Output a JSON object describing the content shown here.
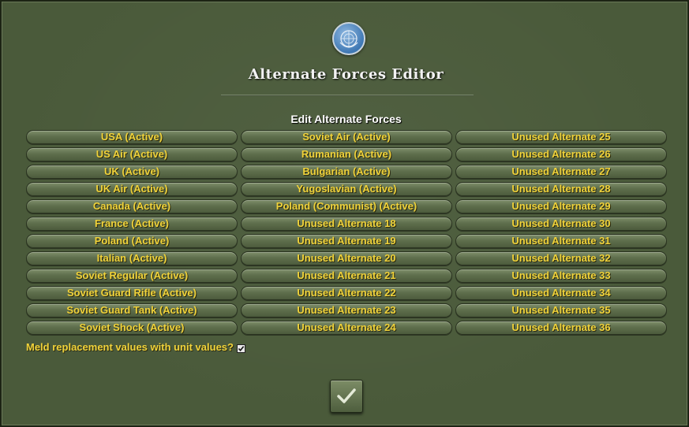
{
  "dialog": {
    "title": "Alternate Forces Editor",
    "subtitle": "Edit Alternate Forces"
  },
  "forces": {
    "column1": [
      "USA (Active)",
      "US Air (Active)",
      "UK (Active)",
      "UK Air (Active)",
      "Canada (Active)",
      "France (Active)",
      "Poland (Active)",
      "Italian (Active)",
      "Soviet Regular (Active)",
      "Soviet Guard Rifle (Active)",
      "Soviet Guard Tank (Active)",
      "Soviet Shock (Active)"
    ],
    "column2": [
      "Soviet Air (Active)",
      "Rumanian (Active)",
      "Bulgarian (Active)",
      "Yugoslavian (Active)",
      "Poland (Communist) (Active)",
      "Unused Alternate 18",
      "Unused Alternate 19",
      "Unused Alternate 20",
      "Unused Alternate 21",
      "Unused Alternate 22",
      "Unused Alternate 23",
      "Unused Alternate 24"
    ],
    "column3": [
      "Unused Alternate 25",
      "Unused Alternate 26",
      "Unused Alternate 27",
      "Unused Alternate 28",
      "Unused Alternate 29",
      "Unused Alternate 30",
      "Unused Alternate 31",
      "Unused Alternate 32",
      "Unused Alternate 33",
      "Unused Alternate 34",
      "Unused Alternate 35",
      "Unused Alternate 36"
    ]
  },
  "meld": {
    "label": "Meld replacement values with unit values?",
    "checked": true
  },
  "icons": {
    "emblem": "un-emblem-icon",
    "ok": "checkmark-icon",
    "checkbox": "checkbox-checked-icon"
  },
  "colors": {
    "button_text": "#f0d23a",
    "panel": "#4a5a3a"
  }
}
